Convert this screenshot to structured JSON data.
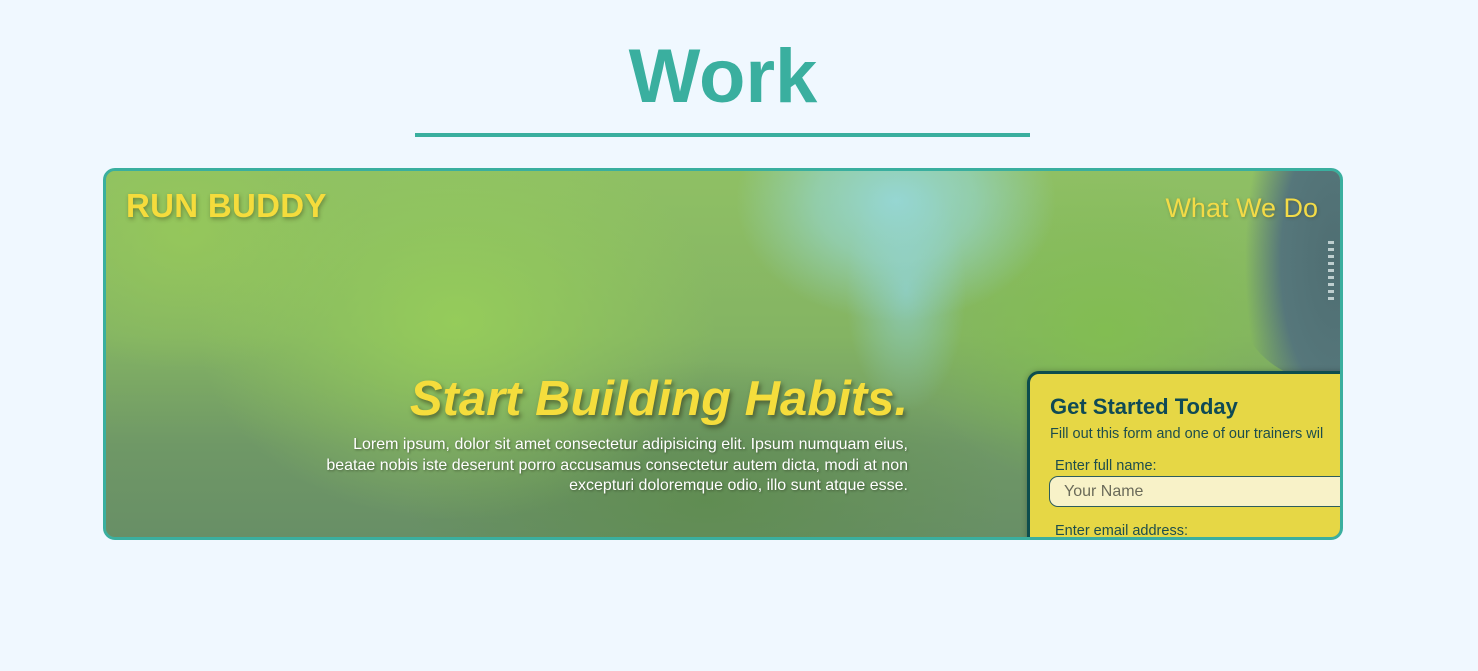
{
  "section": {
    "title": "Work"
  },
  "project": {
    "brand": "RUN BUDDY",
    "nav_link": "What We Do",
    "headline": "Start Building Habits.",
    "body": "Lorem ipsum, dolor sit amet consectetur adipisicing elit. Ipsum numquam eius, beatae nobis iste deserunt porro accusamus consectetur autem dicta, modi at non excepturi doloremque odio, illo sunt atque esse.",
    "form": {
      "title": "Get Started Today",
      "subtitle": "Fill out this form and one of our trainers wil",
      "name_label": "Enter full name:",
      "name_placeholder": "Your Name",
      "email_label": "Enter email address:"
    }
  },
  "colors": {
    "accent": "#3aaf9f",
    "background": "#f0f8ff",
    "brand_yellow": "#f5dc3c",
    "form_background": "#e6d745",
    "form_border": "#0d4d4d"
  }
}
